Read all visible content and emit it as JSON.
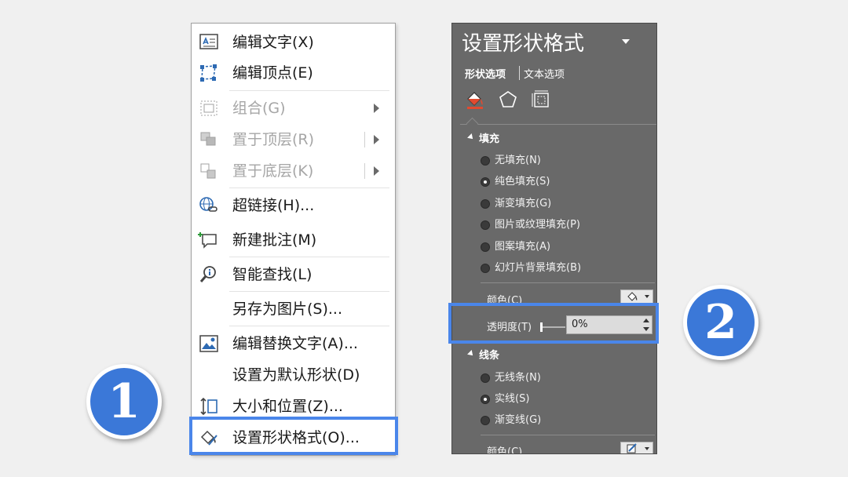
{
  "context_menu": {
    "items": [
      {
        "label": "编辑文字(X)",
        "icon": "edit-text-icon",
        "disabled": false
      },
      {
        "label": "编辑顶点(E)",
        "icon": "edit-points-icon",
        "disabled": false
      },
      {
        "label": "组合(G)",
        "icon": "group-icon",
        "disabled": true,
        "submenu": true
      },
      {
        "label": "置于顶层(R)",
        "icon": "bring-to-front-icon",
        "disabled": true,
        "submenu": true
      },
      {
        "label": "置于底层(K)",
        "icon": "send-to-back-icon",
        "disabled": true,
        "submenu": true
      },
      {
        "label": "超链接(H)...",
        "icon": "hyperlink-icon",
        "disabled": false
      },
      {
        "label": "新建批注(M)",
        "icon": "new-comment-icon",
        "disabled": false
      },
      {
        "label": "智能查找(L)",
        "icon": "smart-lookup-icon",
        "disabled": false
      },
      {
        "label": "另存为图片(S)...",
        "icon": "",
        "disabled": false
      },
      {
        "label": "编辑替换文字(A)...",
        "icon": "alt-text-icon",
        "disabled": false
      },
      {
        "label": "设置为默认形状(D)",
        "icon": "",
        "disabled": false
      },
      {
        "label": "大小和位置(Z)...",
        "icon": "size-position-icon",
        "disabled": false
      },
      {
        "label": "设置形状格式(O)...",
        "icon": "format-shape-icon",
        "disabled": false,
        "highlighted": true
      }
    ]
  },
  "format_pane": {
    "title": "设置形状格式",
    "tabs": {
      "shape": "形状选项",
      "text": "文本选项"
    },
    "icons": [
      "fill-line-icon",
      "effects-icon",
      "size-properties-icon"
    ],
    "fill": {
      "header": "填充",
      "options": [
        {
          "label": "无填充(N)",
          "selected": false
        },
        {
          "label": "纯色填充(S)",
          "selected": true
        },
        {
          "label": "渐变填充(G)",
          "selected": false
        },
        {
          "label": "图片或纹理填充(P)",
          "selected": false
        },
        {
          "label": "图案填充(A)",
          "selected": false
        },
        {
          "label": "幻灯片背景填充(B)",
          "selected": false
        }
      ],
      "color_label": "颜色(C)",
      "transparency_label": "透明度(T)",
      "transparency_value": "0%"
    },
    "line": {
      "header": "线条",
      "options": [
        {
          "label": "无线条(N)",
          "selected": false
        },
        {
          "label": "实线(S)",
          "selected": true
        },
        {
          "label": "渐变线(G)",
          "selected": false
        }
      ],
      "color_label": "颜色(C)"
    }
  },
  "badges": {
    "step1": "1",
    "step2": "2"
  },
  "colors": {
    "highlight": "#4a86ea",
    "badge": "#3b78d8",
    "pane_bg": "#696969"
  }
}
